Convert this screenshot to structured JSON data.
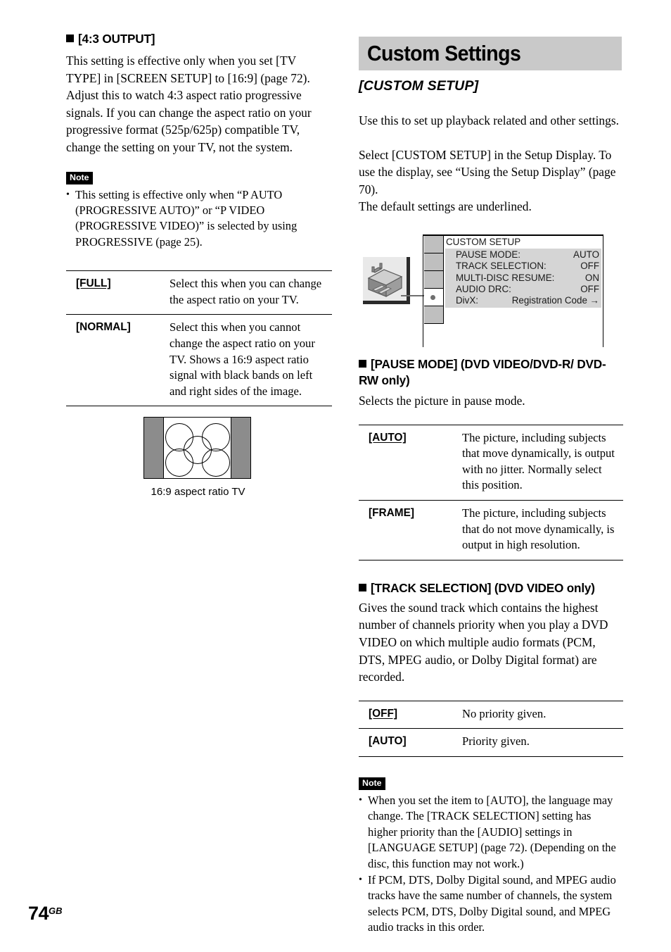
{
  "page": {
    "number": "74",
    "region_suffix": "GB"
  },
  "left_column": {
    "heading": "[4:3 OUTPUT]",
    "body": "This setting is effective only when you set [TV TYPE] in [SCREEN SETUP] to [16:9] (page 72). Adjust this to watch 4:3 aspect ratio progressive signals. If you can change the aspect ratio on your progressive format (525p/625p) compatible TV, change the setting on your TV, not the system.",
    "note": {
      "badge": "Note",
      "items": [
        "This setting is effective only when “P AUTO (PROGRESSIVE AUTO)” or “P VIDEO (PROGRESSIVE VIDEO)” is selected by using PROGRESSIVE (page 25)."
      ]
    },
    "options_table": {
      "rows": [
        {
          "term": "[FULL]",
          "is_default": true,
          "description": "Select this when you can change the aspect ratio on your TV."
        },
        {
          "term": "[NORMAL]",
          "is_default": false,
          "description": "Select this when you cannot change the aspect ratio on your TV. Shows a 16:9 aspect ratio signal with black bands on left and right sides of the image."
        }
      ]
    },
    "figure": {
      "caption": "16:9 aspect ratio TV",
      "band_color": "#8c8c8c",
      "circle_count": 5
    }
  },
  "right_column": {
    "banner_title": "Custom Settings",
    "sub_title": "[CUSTOM SETUP]",
    "intro_1": "Use this to set up playback related and other settings.",
    "intro_2": "Select [CUSTOM SETUP] in the Setup Display. To use the display, see “Using the Setup Display” (page 70).\nThe default settings are underlined.",
    "setup_display": {
      "icon_name": "toolbox-icon",
      "tab_count": 5,
      "selected_tab_index": 4,
      "menu_title": "CUSTOM SETUP",
      "menu_rows": [
        {
          "label": "PAUSE MODE:",
          "value": "AUTO"
        },
        {
          "label": "TRACK SELECTION:",
          "value": "OFF"
        },
        {
          "label": "MULTI-DISC RESUME:",
          "value": "ON"
        },
        {
          "label": "AUDIO DRC:",
          "value": "OFF"
        },
        {
          "label": "DivX:",
          "value": "Registration Code →"
        }
      ]
    },
    "pause_mode": {
      "heading": "[PAUSE MODE] (DVD VIDEO/DVD-R/ DVD-RW only)",
      "intro": "Selects the picture in pause mode.",
      "rows": [
        {
          "term": "[AUTO]",
          "is_default": true,
          "description": "The picture, including subjects that move dynamically, is output with no jitter. Normally select this position."
        },
        {
          "term": "[FRAME]",
          "is_default": false,
          "description": "The picture, including subjects that do not move dynamically, is output in high resolution."
        }
      ]
    },
    "track_selection": {
      "heading": "[TRACK SELECTION] (DVD VIDEO only)",
      "intro": "Gives the sound track which contains the highest number of channels priority when you play a DVD VIDEO on which multiple audio formats (PCM, DTS, MPEG audio, or Dolby Digital format) are recorded.",
      "rows": [
        {
          "term": "[OFF]",
          "is_default": true,
          "description": "No priority given."
        },
        {
          "term": "[AUTO]",
          "is_default": false,
          "description": "Priority given."
        }
      ]
    },
    "note": {
      "badge": "Note",
      "items": [
        "When you set the item to [AUTO], the language may change. The [TRACK SELECTION] setting has higher priority than the [AUDIO] settings in [LANGUAGE SETUP] (page 72). (Depending on the disc, this function may not work.)",
        "If PCM, DTS, Dolby Digital sound, and MPEG audio tracks have the same number of channels, the system selects PCM, DTS, Dolby Digital sound, and MPEG audio tracks in this order."
      ]
    }
  }
}
